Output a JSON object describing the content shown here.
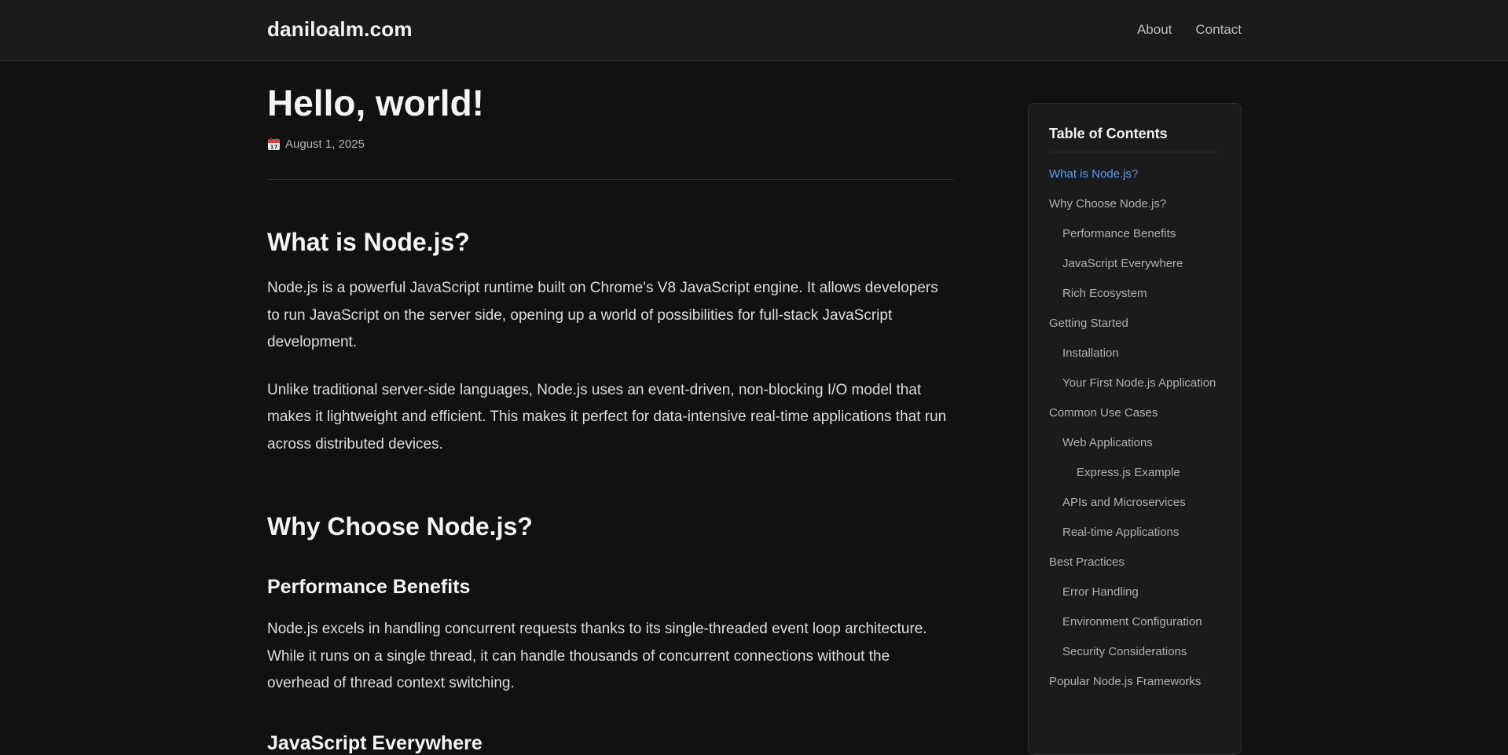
{
  "header": {
    "brand": "daniloalm.com",
    "nav": [
      {
        "label": "About"
      },
      {
        "label": "Contact"
      }
    ]
  },
  "post": {
    "title": "Hello, world!",
    "date_icon": "calendar-icon",
    "date": "August 1, 2025"
  },
  "content": {
    "section1": {
      "heading": "What is Node.js?",
      "paragraphs": [
        "Node.js is a powerful JavaScript runtime built on Chrome's V8 JavaScript engine. It allows developers to run JavaScript on the server side, opening up a world of possibilities for full-stack JavaScript development.",
        "Unlike traditional server-side languages, Node.js uses an event-driven, non-blocking I/O model that makes it lightweight and efficient. This makes it perfect for data-intensive real-time applications that run across distributed devices."
      ]
    },
    "section2": {
      "heading": "Why Choose Node.js?",
      "sub1": {
        "heading": "Performance Benefits",
        "paragraph": "Node.js excels in handling concurrent requests thanks to its single-threaded event loop architecture. While it runs on a single thread, it can handle thousands of concurrent connections without the overhead of thread context switching."
      },
      "sub2": {
        "heading": "JavaScript Everywhere"
      }
    }
  },
  "toc": {
    "title": "Table of Contents",
    "active_color": "#5b9df5",
    "items": [
      {
        "label": "What is Node.js?",
        "level": 1,
        "active": true
      },
      {
        "label": "Why Choose Node.js?",
        "level": 1
      },
      {
        "label": "Performance Benefits",
        "level": 2
      },
      {
        "label": "JavaScript Everywhere",
        "level": 2
      },
      {
        "label": "Rich Ecosystem",
        "level": 2
      },
      {
        "label": "Getting Started",
        "level": 1
      },
      {
        "label": "Installation",
        "level": 2
      },
      {
        "label": "Your First Node.js Application",
        "level": 2
      },
      {
        "label": "Common Use Cases",
        "level": 1
      },
      {
        "label": "Web Applications",
        "level": 2
      },
      {
        "label": "Express.js Example",
        "level": 3
      },
      {
        "label": "APIs and Microservices",
        "level": 2
      },
      {
        "label": "Real-time Applications",
        "level": 2
      },
      {
        "label": "Best Practices",
        "level": 1
      },
      {
        "label": "Error Handling",
        "level": 2
      },
      {
        "label": "Environment Configuration",
        "level": 2
      },
      {
        "label": "Security Considerations",
        "level": 2
      },
      {
        "label": "Popular Node.js Frameworks",
        "level": 1
      }
    ]
  }
}
